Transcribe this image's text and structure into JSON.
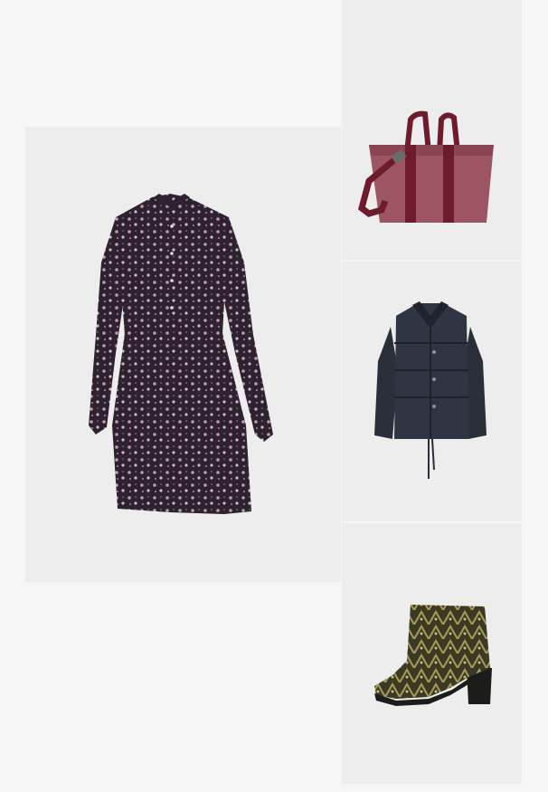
{
  "colors": {
    "page_background": "#f6f6f6",
    "tile_background": "#ededed",
    "dress": "#2d2230",
    "dress_print": "#c49aae",
    "bag_body": "#9e5563",
    "bag_strap": "#6e1b2c",
    "jacket": "#2a2f3a",
    "boot": "#3c3a26",
    "boot_print": "#a89a55"
  },
  "outfit": {
    "items": [
      {
        "id": "dress",
        "product": "floral-print-shirt-dress"
      },
      {
        "id": "bag",
        "product": "tote-bag"
      },
      {
        "id": "jacket",
        "product": "puffer-jacket"
      },
      {
        "id": "boot",
        "product": "printed-ankle-boot"
      }
    ]
  }
}
